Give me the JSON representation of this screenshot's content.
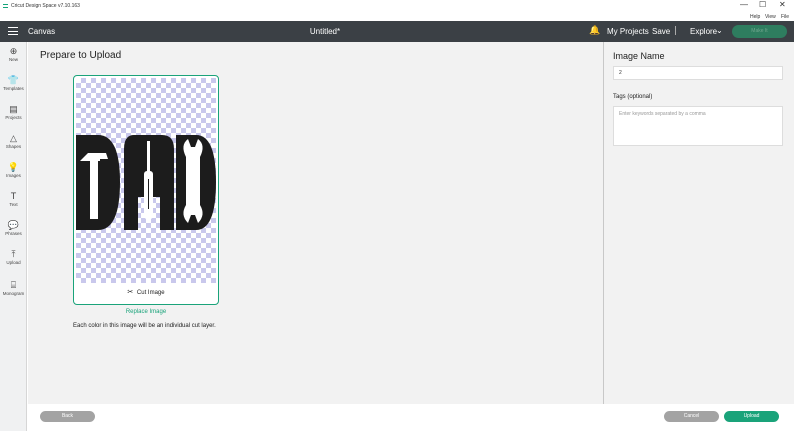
{
  "window": {
    "title": "Cricut Design Space  v7.10.163",
    "controls": [
      "—",
      "☐",
      "✕"
    ],
    "menu": [
      "Help",
      "View",
      "File"
    ]
  },
  "appbar": {
    "section": "Canvas",
    "doc_title": "Untitled*",
    "bell_icon": "bell-icon",
    "my_projects": "My Projects",
    "save": "Save",
    "explore": "Explore",
    "make_it": "Make It"
  },
  "toolbar": [
    {
      "icon": "⊕",
      "label": "New"
    },
    {
      "icon": "👕",
      "label": "Templates"
    },
    {
      "icon": "▤",
      "label": "Projects"
    },
    {
      "icon": "△",
      "label": "Shapes"
    },
    {
      "icon": "💡",
      "label": "Images"
    },
    {
      "icon": "T",
      "label": "Text"
    },
    {
      "icon": "💬",
      "label": "Phrases"
    },
    {
      "icon": "⤒",
      "label": "Upload"
    },
    {
      "icon": "⌸",
      "label": "Monogram"
    }
  ],
  "main": {
    "title": "Prepare to Upload",
    "cut_image": "Cut Image",
    "replace_image": "Replace Image",
    "info": "Each color in this image will be an individual cut layer."
  },
  "right": {
    "name_label": "Image Name",
    "name_value": "2",
    "tags_label": "Tags (optional)",
    "tags_placeholder": "Enter keywords separated by a comma"
  },
  "footer": {
    "back": "Back",
    "cancel": "Cancel",
    "upload": "Upload"
  },
  "colors": {
    "accent": "#1aa37a",
    "appbar": "#3b4045",
    "checker": "#c9c8ec"
  }
}
